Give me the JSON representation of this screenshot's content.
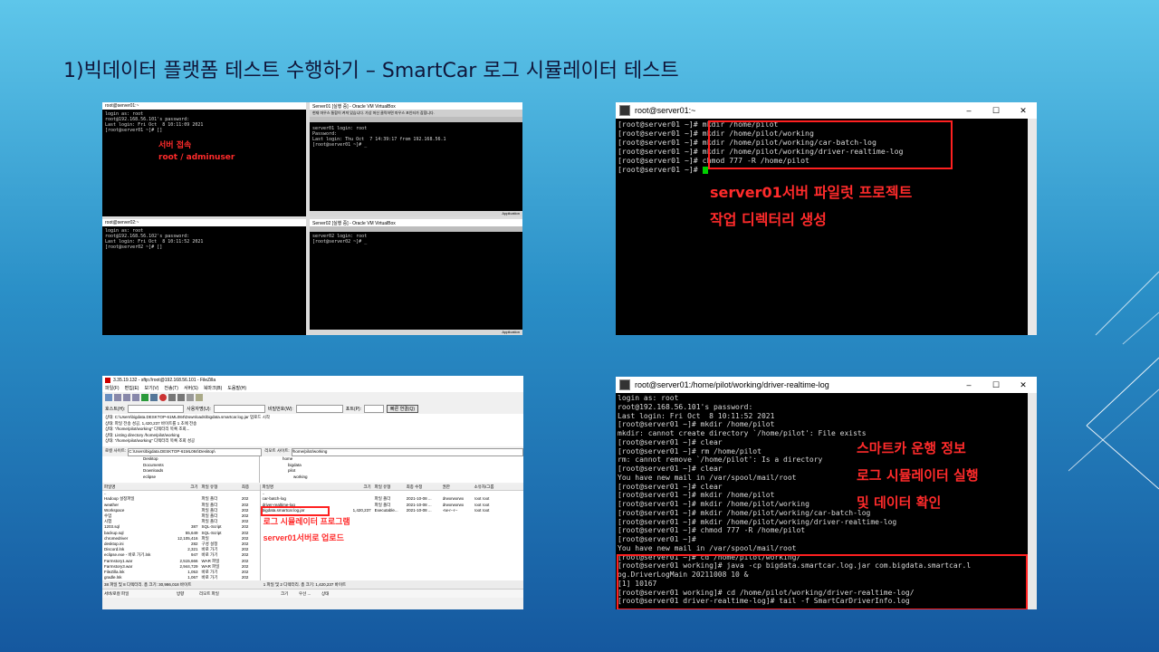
{
  "slide": {
    "title": "1)빅데이터 플랫폼 테스트 수행하기 – SmartCar  로그 시뮬레이터 테스트"
  },
  "panel_a": {
    "tl_title": "root@server01:~",
    "tl_lines": [
      "login as: root",
      "root@192.168.56.101's password:",
      "Last login: Fri Oct  8 10:11:09 2021",
      "[root@server01 ~]# []"
    ],
    "annot1": "서버 접속",
    "annot2": "root / adminuser",
    "tr_title": "Server01 [실행 중] - Oracle VM VirtualBox",
    "tr_warn": "현재 마우스 통합이 켜져 있습니다. 가상 머신 클릭하면 마우스 포인터가 잡힙니다.",
    "tr_lines": [
      "server01 login: root",
      "Password:",
      "Last login: Thu Oct  7 14:39:17 from 192.168.56.1",
      "[root@server01 ~]# _"
    ],
    "bl_title": "root@server02:~",
    "bl_lines": [
      "login as: root",
      "root@192.168.56.102's password:",
      "Last login: Fri Oct  8 10:11:52 2021",
      "[root@server02 ~]# []"
    ],
    "br_title": "Server02 [실행 중] - Oracle VM VirtualBox",
    "br_lines": [
      "server02 login: root",
      "[root@server02 ~]# _"
    ],
    "status_app": "Application"
  },
  "panel_b": {
    "title": "root@server01:~",
    "lines": [
      "[root@server01 ~]# mkdir /home/pilot",
      "[root@server01 ~]# mkdir /home/pilot/working",
      "[root@server01 ~]# mkdir /home/pilot/working/car-batch-log",
      "[root@server01 ~]# mkdir /home/pilot/working/driver-realtime-log",
      "[root@server01 ~]# chmod 777 -R /home/pilot",
      "[root@server01 ~]# "
    ],
    "annot1": "server01서버 파일럿 프로젝트",
    "annot2": "작업 디렉터리 생성"
  },
  "panel_c": {
    "title": "3.35.19.132 - sftp://root@192.168.56.101 - FileZilla",
    "menu": [
      "파일(F)",
      "편집(E)",
      "보기(V)",
      "전송(T)",
      "서버(S)",
      "북마크(B)",
      "도움말(H)"
    ],
    "qc_host_label": "호스트(H):",
    "qc_user_label": "사용자명(U):",
    "qc_pass_label": "비밀번호(W):",
    "qc_port_label": "포트(P):",
    "qc_button": "빠른 연결(Q)",
    "log": [
      "상태:   C:\\Users\\bigdata.DESKTOP-61ML084\\Downloads\\bigdata.smartcar.log.jar 업로드 시작",
      "상태:   파일 전송 성공, 1,420,237 바이트를 1 초에 전송",
      "상태:   \"/home/pilot/working\" 디렉터리 목록 조회...",
      "상태:   Listing directory /home/pilot/working",
      "상태:   \"/home/pilot/working\" 디렉터리 목록 조회 성공"
    ],
    "local_site_label": "로컬 사이트:",
    "local_site_path": "C:\\Users\\bigdata.DESKTOP-61ML084\\Desktop\\",
    "remote_site_label": "리모트 사이트:",
    "remote_site_path": "/home/pilot/working",
    "local_tree": [
      "Desktop",
      "Documents",
      "Downloads",
      "eclipse"
    ],
    "remote_tree": [
      "home",
      "bigdata",
      "pilot",
      "working"
    ],
    "local_headers": [
      "파일명",
      "크기",
      "파일 유형",
      "최종"
    ],
    "local_files": [
      [
        "..",
        "",
        "",
        ""
      ],
      [
        "Hadoop 설정파일",
        "",
        "파일 폴더",
        "202"
      ],
      [
        "weather",
        "",
        "파일 폴더",
        "202"
      ],
      [
        "Workspace",
        "",
        "파일 폴더",
        "202"
      ],
      [
        "수업",
        "",
        "파일 폴더",
        "202"
      ],
      [
        "시험",
        "",
        "파일 폴더",
        "202"
      ],
      [
        "1203.sql",
        "387",
        "SQL-Script",
        "202"
      ],
      [
        "backup.sql",
        "55,649",
        "SQL-Script",
        "202"
      ],
      [
        "chromedriver",
        "12,105,416",
        "파일",
        "202"
      ],
      [
        "desktop.ini",
        "282",
        "구성 설정",
        "202"
      ],
      [
        "Discord.lnk",
        "2,321",
        "바로 가기",
        "202"
      ],
      [
        "eclipse.exe - 바로 가기.lnk",
        "947",
        "바로 가기",
        "202"
      ],
      [
        "Farmstory1.war",
        "2,515,666",
        "WAR 파일",
        "202"
      ],
      [
        "Farmstory3.war",
        "2,944,729",
        "WAR 파일",
        "202"
      ],
      [
        "FileZilla.lnk",
        "1,053",
        "바로 가기",
        "202"
      ],
      [
        "gradle.lnk",
        "1,067",
        "바로 가기",
        "202"
      ]
    ],
    "remote_headers": [
      "파일명",
      "크기",
      "파일 유형",
      "최종 수정",
      "권한",
      "소유자/그룹"
    ],
    "remote_files": [
      [
        "..",
        "",
        "",
        "",
        "",
        ""
      ],
      [
        "car-batch-log",
        "",
        "파일 폴더",
        "2021-10-08 ...",
        "drwxrwxrwx",
        "root root"
      ],
      [
        "driver-realtime-log",
        "",
        "파일 폴더",
        "2021-10-08 ...",
        "drwxrwxrwx",
        "root root"
      ],
      [
        "bigdata.smartcar.log.jar",
        "1,420,237",
        "Executable...",
        "2021-10-08 ...",
        "-rw-r--r--",
        "root root"
      ]
    ],
    "annot1": "로그 시뮬레이터 프로그램",
    "annot2": "server01서버로 업로드",
    "local_status": "38 파일 및 8 디렉터리. 총 크기: 30,986,018 바이트",
    "remote_status": "1 파일 및 2 디렉터리. 총 크기: 1,420,237 바이트",
    "queue_headers": [
      "서버/로컬 파일",
      "방향",
      "리모트 파일",
      "크기",
      "우선 ...",
      "상태"
    ]
  },
  "panel_d": {
    "title": "root@server01:/home/pilot/working/driver-realtime-log",
    "lines": [
      "login as: root",
      "root@192.168.56.101's password:",
      "Last login: Fri Oct  8 10:11:52 2021",
      "[root@server01 ~]# mkdir /home/pilot",
      "mkdir: cannot create directory `/home/pilot': File exists",
      "[root@server01 ~]# clear",
      "[root@server01 ~]# rm /home/pilot",
      "rm: cannot remove `/home/pilot': Is a directory",
      "[root@server01 ~]# clear",
      "You have new mail in /var/spool/mail/root",
      "[root@server01 ~]# clear",
      "[root@server01 ~]# mkdir /home/pilot",
      "[root@server01 ~]# mkdir /home/pilot/working",
      "[root@server01 ~]# mkdir /home/pilot/working/car-batch-log",
      "[root@server01 ~]# mkdir /home/pilot/working/driver-realtime-log",
      "[root@server01 ~]# chmod 777 -R /home/pilot",
      "[root@server01 ~]#",
      "You have new mail in /var/spool/mail/root",
      "[root@server01 ~]# cd /home/pilot/working/",
      "[root@server01 working]# java -cp bigdata.smartcar.log.jar com.bigdata.smartcar.l",
      "og.DriverLogMain 20211008 10 &",
      "[1] 10167",
      "[root@server01 working]# cd /home/pilot/working/driver-realtime-log/",
      "[root@server01 driver-realtime-log]# tail -f SmartCarDriverInfo.log"
    ],
    "annot1": "스마트카 운행 정보",
    "annot2": "로그 시뮬레이터 실행",
    "annot3": "및 데이터 확인"
  },
  "colors": {
    "annotation": "#ff2b2b",
    "terminal_bg": "#000000",
    "terminal_text": "#d8d8d8",
    "cursor": "#00d000"
  }
}
